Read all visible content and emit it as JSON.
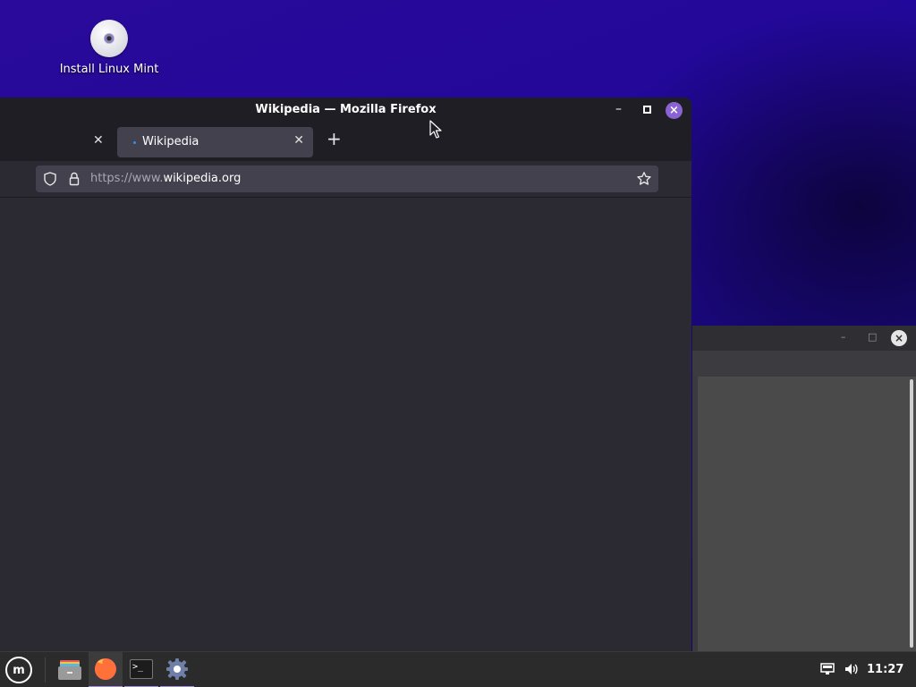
{
  "desktop": {
    "icons": [
      {
        "label": "Install Linux Mint",
        "icon": "disc-icon"
      }
    ]
  },
  "firefox_window": {
    "title": "Wikipedia — Mozilla Firefox",
    "tabs": [
      {
        "label": "",
        "active": false
      },
      {
        "label": "Wikipedia",
        "active": true
      }
    ],
    "url_prefix": "https://www.",
    "url_domain": "wikipedia.org",
    "controls": {
      "minimize": "–",
      "close": "×"
    }
  },
  "background_window": {
    "controls": {
      "minimize": "–",
      "maximize": "□",
      "close": "×"
    }
  },
  "taskbar": {
    "menu_label": "m",
    "apps": [
      "file-manager-icon",
      "firefox-icon",
      "terminal-icon",
      "settings-icon"
    ],
    "terminal_glyph": ">_",
    "clock": "11:27"
  },
  "colors": {
    "accent": "#8a63d2",
    "taskbar_indicator": "#a58fe0",
    "desktop_bg": "#22089a"
  }
}
